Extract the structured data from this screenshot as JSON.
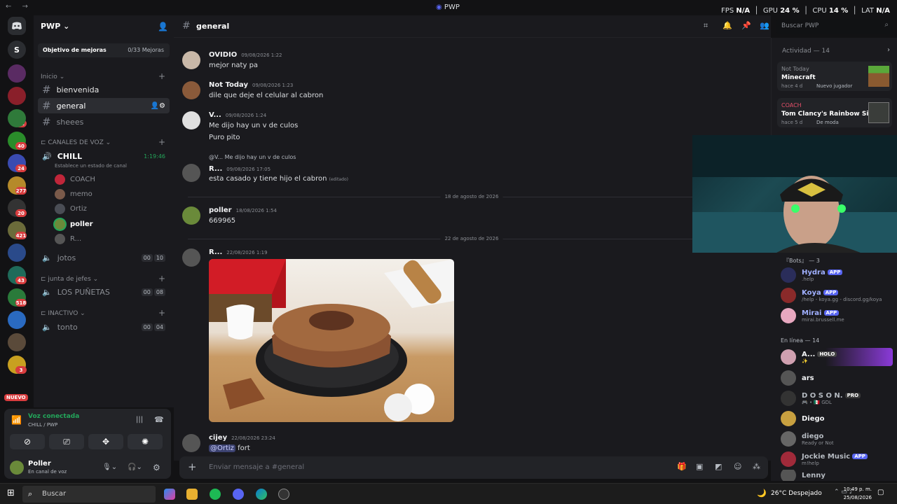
{
  "window": {
    "title": "PWP",
    "nav": "← →",
    "fps_label": "FPS",
    "fps": "N/A",
    "gpu_label": "GPU",
    "gpu": "24 %",
    "cpu_label": "CPU",
    "cpu": "14 %",
    "lat_label": "LAT",
    "lat": "N/A"
  },
  "rail": {
    "top_letter": "S",
    "badges": [
      "61",
      "40",
      "24",
      "277",
      "20",
      "421",
      "43",
      "518",
      "3"
    ],
    "new_label": "NUEVO"
  },
  "server": {
    "name": "PWP",
    "boost_label": "Objetivo de mejoras",
    "boost_count": "0/33 Mejoras"
  },
  "channels": {
    "inicio_label": "Inicio",
    "text": [
      {
        "name": "bienvenida"
      },
      {
        "name": "general"
      },
      {
        "name": "sheees"
      }
    ],
    "voice_cat": "CANALES DE VOZ",
    "chill": {
      "name": "CHILL",
      "time": "1:19:46",
      "status": "Establece un estado de canal"
    },
    "voice_users": [
      "COACH",
      "memo",
      "Ortiz",
      "poller",
      "R..."
    ],
    "jotos": {
      "name": "jotos",
      "a": "00",
      "b": "10"
    },
    "jefes_cat": "junta de jefes",
    "punetas": {
      "name": "LOS PUÑETAS",
      "a": "00",
      "b": "08"
    },
    "inactivo_cat": "INACTIVO",
    "tonto": {
      "name": "tonto",
      "a": "00",
      "b": "04"
    }
  },
  "voice": {
    "status": "Voz conectada",
    "channel": "CHILL / PWP"
  },
  "user": {
    "name": "Poller",
    "status": "En canal de voz"
  },
  "header": {
    "channel": "general",
    "search_placeholder": "Buscar PWP"
  },
  "messages": [
    {
      "name": "OVIDIO",
      "time": "09/08/2026 1:22",
      "lines": [
        "mejor naty pa"
      ]
    },
    {
      "name": "Not Today",
      "time": "09/08/2026 1:23",
      "lines": [
        "dile que deje el celular al cabron"
      ]
    },
    {
      "name": "V...",
      "time": "09/08/2026 1:24",
      "lines": [
        "Me dijo hay un v de culos",
        "Puro pito"
      ]
    },
    {
      "name": "R...",
      "time": "09/08/2026 17:05",
      "reply": "@V...  Me dijo hay un v de culos",
      "lines": [
        "esta casado y tiene hijo el cabron"
      ],
      "edited": "(editado)"
    },
    {
      "name": "poller",
      "time": "18/08/2026 1:54",
      "lines": [
        "669965"
      ]
    },
    {
      "name": "R...",
      "time": "22/08/2026 1:19",
      "lines": []
    },
    {
      "name": "cijey",
      "time": "22/08/2026 23:24",
      "mention": "@Ortiz",
      "lines": [
        "fort"
      ]
    }
  ],
  "dividers": [
    "18 de agosto de 2026",
    "22 de agosto de 2026"
  ],
  "input": {
    "placeholder": "Enviar mensaje a #general"
  },
  "activity": {
    "title": "Actividad — 14",
    "cards": [
      {
        "user": "Not Today",
        "game": "Minecraft",
        "meta": "hace 4 d",
        "tag": "Nuevo jugador"
      },
      {
        "user": "COACH",
        "game": "Tom Clancy's Rainbow Six ...",
        "meta": "hace 5 d",
        "tag": "De moda"
      }
    ]
  },
  "members": {
    "bots_header": "『Bots』 — 3",
    "bots": [
      {
        "name": "Hydra",
        "sub": ".help",
        "badge": "APP"
      },
      {
        "name": "Koya",
        "sub": "/help - koya.gg - discord.gg/koya",
        "badge": "APP"
      },
      {
        "name": "Mirai",
        "sub": "mirai.brussell.me",
        "badge": "APP"
      }
    ],
    "online_header": "En línea — 14",
    "online": [
      {
        "name": "A...",
        "sub": "✨",
        "badge": "HOLO"
      },
      {
        "name": "ars",
        "sub": ""
      },
      {
        "name": "D O S O N.",
        "sub": "🎮 • 🇲🇽 GDL",
        "badge": "PRO"
      },
      {
        "name": "Diego",
        "sub": ""
      },
      {
        "name": "diego",
        "sub": "Ready or Not"
      },
      {
        "name": "Jockie Music",
        "sub": "m!help",
        "badge": "APP"
      },
      {
        "name": "Lenny",
        "sub": ""
      }
    ]
  },
  "taskbar": {
    "search": "Buscar",
    "weather": "26°C  Despejado",
    "time": "10:49 p. m.",
    "date": "25/08/2026"
  },
  "colors": {
    "bg": "#1a1a1e",
    "accent": "#5865f2",
    "online": "#23a55a",
    "danger": "#d83c3e"
  }
}
